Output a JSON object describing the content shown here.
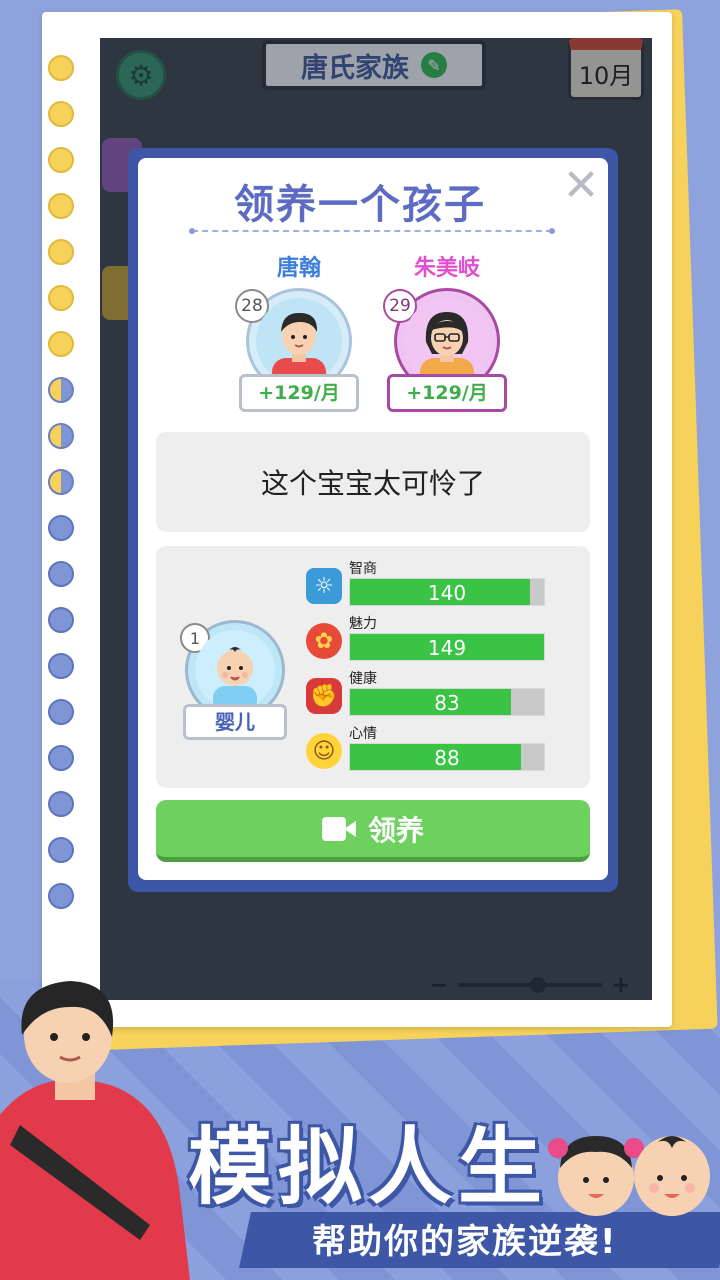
{
  "game": {
    "family_name": "唐氏家族",
    "month": "10月"
  },
  "dialog": {
    "title": "领养一个孩子",
    "close_symbol": "✕",
    "message": "这个宝宝太可怜了",
    "adopt_label": "领养"
  },
  "parents": [
    {
      "name": "唐翰",
      "age": "28",
      "income": "+129/月",
      "color": "#3d7ed8"
    },
    {
      "name": "朱美岐",
      "age": "29",
      "income": "+129/月",
      "color": "#e04fd0"
    }
  ],
  "child": {
    "age": "1",
    "label": "婴儿"
  },
  "stats": [
    {
      "label": "智商",
      "value": "140",
      "fill": 0.93,
      "icon": "brain-icon"
    },
    {
      "label": "魅力",
      "value": "149",
      "fill": 1.0,
      "icon": "flower-icon"
    },
    {
      "label": "健康",
      "value": "83",
      "fill": 0.83,
      "icon": "muscle-icon"
    },
    {
      "label": "心情",
      "value": "88",
      "fill": 0.88,
      "icon": "smiley-icon"
    }
  ],
  "promo": {
    "headline": "模拟人生",
    "tagline": "帮助你的家族逆袭!"
  },
  "colors": {
    "accent_blue": "#3e56a6",
    "bar_green": "#3ac345",
    "button_green": "#6ed05f"
  }
}
